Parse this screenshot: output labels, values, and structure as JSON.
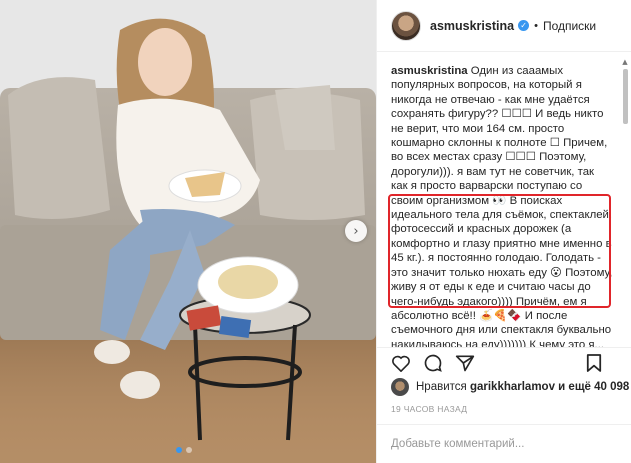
{
  "post": {
    "username": "asmuskristina",
    "follow_label": "Подписки",
    "separator": "•",
    "verified_mark": "✓",
    "caption_username": "asmuskristina",
    "caption_text": " Один из сааамых популярных вопросов, на который я никогда не отвечаю - как мне удаётся сохранять фигуру?? ☐☐☐ И ведь никто не верит, что мои 164 см. просто кошмарно склонны к полноте ☐ Причем, во всех местах сразу ☐☐☐ Поэтому, дорогули))). я вам тут не советчик, так как я просто варварски поступаю со своим организмом 👀 В поисках идеального тела для съёмок, спектаклей, фотосессий и красных дорожек (а комфортно и глазу приятно мне именно в 45 кг.). я постоянно голодаю. Голодать - это значит только нюхать еду 😮 Поэтому, живу я от еды к еде и считаю часы до чего-нибудь эдакого)))) Причём, ем я абсолютно всё!! 🍝🍕🍫 И после съемочного дня или спектакля буквально накидываюсь на еду))))))) К чему это я...",
    "likes_prefix": "Нравится",
    "liker": "garikkharlamov",
    "likes_suffix": "и ещё 40 098",
    "time_ago": "19 ЧАСОВ НАЗАД",
    "comment_placeholder": "Добавьте комментарий...",
    "carousel_next_glyph": "›"
  },
  "icons": {
    "like": "heart-icon",
    "comment": "comment-bubble-icon",
    "share": "share-icon",
    "save": "bookmark-icon",
    "verified": "verified-badge-icon",
    "next": "chevron-right-icon"
  },
  "colors": {
    "accent_blue": "#3897f0",
    "highlight_red": "#e0252a",
    "text": "#262626",
    "muted": "#999999"
  }
}
